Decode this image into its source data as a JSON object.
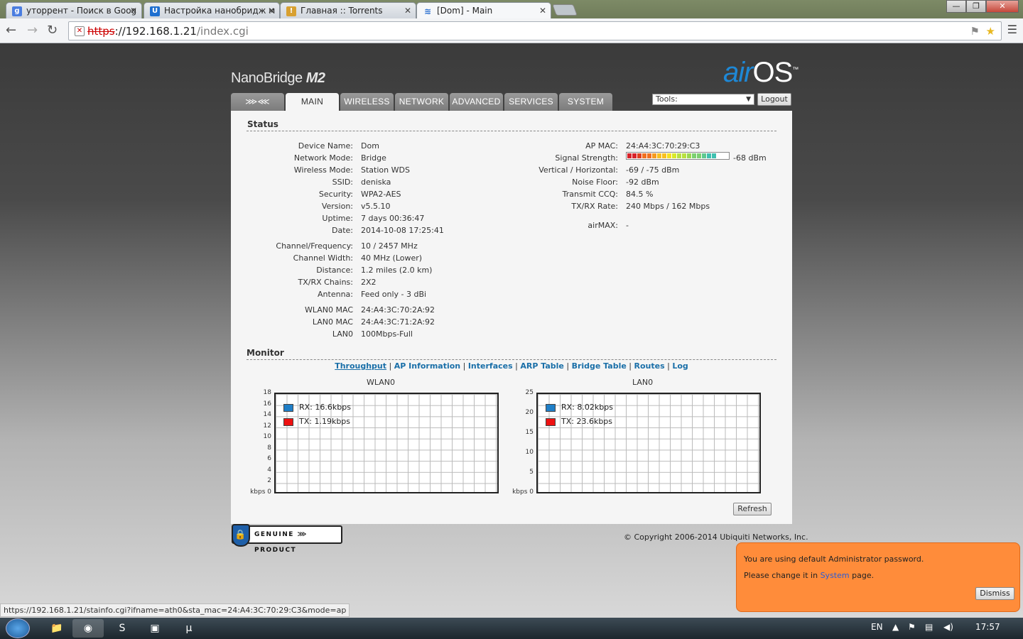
{
  "browser": {
    "tabs": [
      {
        "title": "уторрент - Поиск в Goog",
        "icon": "google-icon"
      },
      {
        "title": "Настройка нанобридж м",
        "icon": "ubiquiti-icon"
      },
      {
        "title": "Главная :: Torrents",
        "icon": "torrents-icon"
      },
      {
        "title": "[Dom] - Main",
        "icon": "feed-icon"
      }
    ],
    "url_scheme": "https",
    "url_host": "://192.168.1.21",
    "url_path": "/index.cgi",
    "status_url": "https://192.168.1.21/stainfo.cgi?ifname=ath0&sta_mac=24:A4:3C:70:29:C3&mode=ap"
  },
  "header": {
    "product": "NanoBridge",
    "model": "M2",
    "brand_air": "air",
    "brand_os": "OS",
    "tm": "™"
  },
  "nav": {
    "tabs": [
      "MAIN",
      "WIRELESS",
      "NETWORK",
      "ADVANCED",
      "SERVICES",
      "SYSTEM"
    ],
    "tools_label": "Tools:",
    "logout": "Logout"
  },
  "status": {
    "title": "Status",
    "left": [
      {
        "label": "Device Name:",
        "value": "Dom"
      },
      {
        "label": "Network Mode:",
        "value": "Bridge"
      },
      {
        "label": "Wireless Mode:",
        "value": "Station WDS"
      },
      {
        "label": "SSID:",
        "value": "deniska"
      },
      {
        "label": "Security:",
        "value": "WPA2-AES"
      },
      {
        "label": "Version:",
        "value": "v5.5.10"
      },
      {
        "label": "Uptime:",
        "value": "7 days 00:36:47"
      },
      {
        "label": "Date:",
        "value": "2014-10-08 17:25:41"
      },
      {
        "label": "Channel/Frequency:",
        "value": "10 / 2457 MHz"
      },
      {
        "label": "Channel Width:",
        "value": "40 MHz (Lower)"
      },
      {
        "label": "Distance:",
        "value": "1.2 miles (2.0 km)"
      },
      {
        "label": "TX/RX Chains:",
        "value": "2X2"
      },
      {
        "label": "Antenna:",
        "value": "Feed only - 3 dBi"
      },
      {
        "label": "WLAN0 MAC",
        "value": "24:A4:3C:70:2A:92"
      },
      {
        "label": "LAN0 MAC",
        "value": "24:A4:3C:71:2A:92"
      },
      {
        "label": "LAN0",
        "value": "100Mbps-Full"
      }
    ],
    "right": [
      {
        "label": "AP MAC:",
        "value": "24:A4:3C:70:29:C3"
      },
      {
        "label": "Signal Strength:",
        "value": "-68 dBm"
      },
      {
        "label": "Vertical / Horizontal:",
        "value": "-69 / -75 dBm"
      },
      {
        "label": "Noise Floor:",
        "value": "-92 dBm"
      },
      {
        "label": "Transmit CCQ:",
        "value": "84.5 %"
      },
      {
        "label": "TX/RX Rate:",
        "value": "240 Mbps / 162 Mbps"
      },
      {
        "label": "airMAX:",
        "value": "-"
      }
    ],
    "signal_level": 0.92,
    "signal_colors": [
      "#d8232a",
      "#e04020",
      "#f07020",
      "#f59a20",
      "#f8c020",
      "#f5e020",
      "#d8e82a",
      "#b8e040",
      "#9ad850",
      "#7cd070",
      "#5ec890",
      "#40c0b0",
      "#2ab8d0",
      "#20a8e0"
    ]
  },
  "monitor": {
    "title": "Monitor",
    "links": [
      "Throughput",
      "AP Information",
      "Interfaces",
      "ARP Table",
      "Bridge Table",
      "Routes",
      "Log"
    ],
    "refresh": "Refresh",
    "charts": [
      {
        "title": "WLAN0",
        "yticks": [
          "18",
          "16",
          "14",
          "12",
          "10",
          "8",
          "6",
          "4",
          "2",
          "kbps 0"
        ],
        "rx": "RX: 16.6kbps",
        "tx": "TX: 1.19kbps"
      },
      {
        "title": "LAN0",
        "yticks": [
          "25",
          "20",
          "15",
          "10",
          "5",
          "kbps 0"
        ],
        "rx": "RX: 8.02kbps",
        "tx": "TX: 23.6kbps"
      }
    ],
    "rx_color": "#1f7fc8",
    "tx_color": "#ee1111"
  },
  "footer": {
    "genuine": "GENUINE",
    "product": "PRODUCT",
    "copyright": "© Copyright 2006-2014 Ubiquiti Networks, Inc."
  },
  "notice": {
    "line1": "You are using default Administrator password.",
    "line2_pre": "Please change it in",
    "line2_link": "System",
    "line2_post": "page.",
    "dismiss": "Dismiss"
  },
  "taskbar": {
    "lang": "EN",
    "time": "17:57"
  }
}
